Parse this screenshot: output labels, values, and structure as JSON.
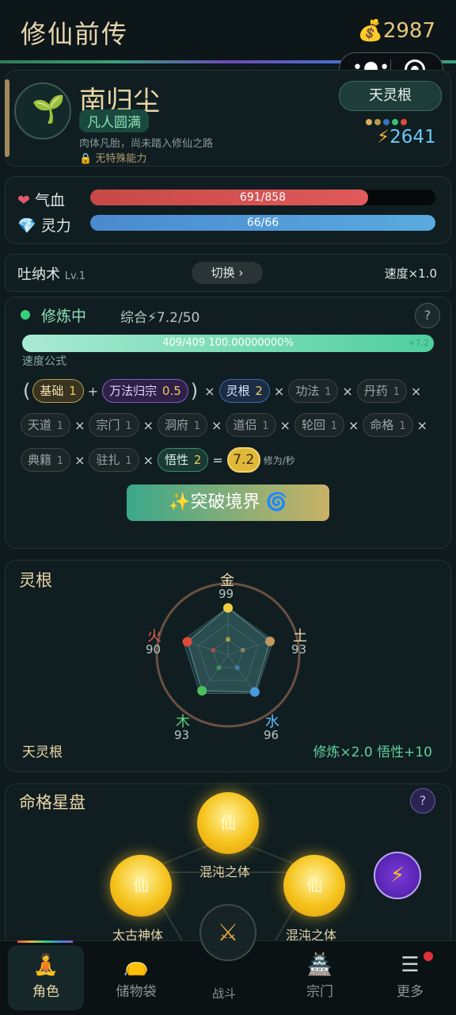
{
  "header": {
    "title": "修仙前传",
    "gold_icon": "money-bag-icon",
    "gold": "2987"
  },
  "profile": {
    "name": "南归尘",
    "realm": "凡人圆满",
    "description": "肉体凡胎，尚未踏入修仙之路",
    "ability": "无特殊能力",
    "root_badge": "天灵根",
    "root_dot_colors": [
      "#d8b060",
      "#b59a4a",
      "#3b6fc0",
      "#3ac070",
      "#e04a3a"
    ],
    "power": "2641"
  },
  "stats": {
    "hp": {
      "label": "气血",
      "text": "691/858",
      "ratio": 0.805,
      "color": "#e05a5a"
    },
    "mp": {
      "label": "灵力",
      "text": "66/66",
      "ratio": 1.0,
      "color": "#5aaae0"
    }
  },
  "breath": {
    "name": "吐纳术",
    "level": "Lv.1",
    "switch_label": "切换 ›",
    "speed": "速度×1.0"
  },
  "cultivation": {
    "status": "修炼中",
    "total": "综合⚡7.2/50",
    "progress_text": "409/409  100.00000000%",
    "progress_ratio": 1.0,
    "progress_hint": "+7.2",
    "formula_label": "速度公式",
    "row1": [
      {
        "label": "基础",
        "value": "1",
        "style": "c-base"
      },
      {
        "label": "万法归宗",
        "value": "0.5",
        "style": "c-purple"
      },
      {
        "label": "灵根",
        "value": "2",
        "style": "c-blue"
      },
      {
        "label": "功法",
        "value": "1",
        "style": ""
      },
      {
        "label": "丹药",
        "value": "1",
        "style": ""
      }
    ],
    "row2": [
      {
        "label": "天道",
        "value": "1"
      },
      {
        "label": "宗门",
        "value": "1"
      },
      {
        "label": "洞府",
        "value": "1"
      },
      {
        "label": "道侣",
        "value": "1"
      },
      {
        "label": "轮回",
        "value": "1"
      },
      {
        "label": "命格",
        "value": "1"
      }
    ],
    "row3": [
      {
        "label": "典籍",
        "value": "1",
        "style": ""
      },
      {
        "label": "驻扎",
        "value": "1",
        "style": ""
      },
      {
        "label": "悟性",
        "value": "2",
        "style": "c-green"
      }
    ],
    "result": "7.2",
    "result_unit": "修为/秒",
    "breakthrough_label": "✨突破境界 🌀"
  },
  "spirit_roots": {
    "title": "灵根",
    "elements": [
      {
        "name": "金",
        "value": 99,
        "color": "#f0d040",
        "name_color": "#e9d6a6"
      },
      {
        "name": "土",
        "value": 93,
        "color": "#c09a60",
        "name_color": "#e9d6a6"
      },
      {
        "name": "水",
        "value": 96,
        "color": "#4a9ae0",
        "name_color": "#6ab8f0"
      },
      {
        "name": "木",
        "value": 93,
        "color": "#4ac060",
        "name_color": "#5fcf7a"
      },
      {
        "name": "火",
        "value": 90,
        "color": "#e04a3a",
        "name_color": "#e05a4a"
      }
    ],
    "type": "天灵根",
    "bonus": "修炼×2.0  悟性+10"
  },
  "fate": {
    "title": "命格星盘",
    "orbs": [
      {
        "symbol": "仙",
        "label": "混沌之体"
      },
      {
        "symbol": "仙",
        "label": "太古神体"
      },
      {
        "symbol": "仙",
        "label": "混沌之体"
      }
    ]
  },
  "nav": {
    "items": [
      {
        "label": "角色",
        "icon": "meditating-figure-icon"
      },
      {
        "label": "储物袋",
        "icon": "treasure-bag-icon"
      },
      {
        "label": "战斗",
        "icon": "crossed-swords-icon"
      },
      {
        "label": "宗门",
        "icon": "pagoda-icon"
      },
      {
        "label": "更多",
        "icon": "menu-icon"
      }
    ]
  }
}
